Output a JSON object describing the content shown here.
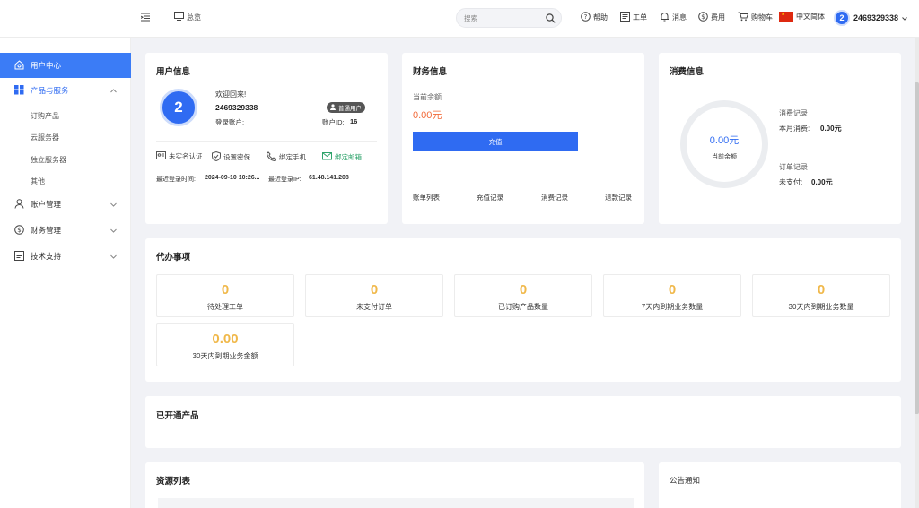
{
  "topbar": {
    "overview_label": "总览",
    "search_placeholder": "搜索",
    "help_label": "帮助",
    "ticket_label": "工单",
    "message_label": "消息",
    "fee_label": "费用",
    "cart_label": "购物车",
    "language_label": "中文简体",
    "user_avatar": "2",
    "username": "2469329338"
  },
  "sidebar": {
    "user_center": "用户中心",
    "products_services": "产品与服务",
    "sub_items": [
      "订购产品",
      "云服务器",
      "独立服务器",
      "其他"
    ],
    "account_mgmt": "账户管理",
    "finance_mgmt": "财务管理",
    "tech_support": "技术支持"
  },
  "user_info": {
    "title": "用户信息",
    "avatar": "2",
    "welcome": "欢迎回来!",
    "username": "2469329338",
    "login_account_label": "登录账户:",
    "role_badge": "普通用户",
    "account_id_label": "账户ID:",
    "account_id": "16",
    "actions": {
      "realname": "未实名认证",
      "security": "设置密保",
      "phone": "绑定手机",
      "email": "绑定邮箱"
    },
    "last_login_time_label": "最近登录时间:",
    "last_login_time": "2024-09-10 10:26...",
    "last_login_ip_label": "最近登录IP:",
    "last_login_ip": "61.48.141.208"
  },
  "finance": {
    "title": "财务信息",
    "balance_label": "当前余额",
    "balance_value": "0.00元",
    "recharge_button": "充值",
    "links": [
      "账单列表",
      "充值记录",
      "消费记录",
      "退款记录"
    ]
  },
  "consumption": {
    "title": "消费信息",
    "ring_value": "0.00元",
    "ring_label": "当前余额",
    "consume_record_label": "消费记录",
    "month_consume_label": "本月消费:",
    "month_consume_value": "0.00元",
    "order_record_label": "订单记录",
    "unpaid_label": "未支付:",
    "unpaid_value": "0.00元"
  },
  "todo": {
    "title": "代办事项",
    "items": [
      {
        "value": "0",
        "label": "待处理工单"
      },
      {
        "value": "0",
        "label": "未支付订单"
      },
      {
        "value": "0",
        "label": "已订购产品数量"
      },
      {
        "value": "0",
        "label": "7天内到期业务数量"
      },
      {
        "value": "0",
        "label": "30天内到期业务数量"
      },
      {
        "value": "0.00",
        "label": "30天内到期业务金额"
      }
    ]
  },
  "opened_products": {
    "title": "已开通产品"
  },
  "resource_list": {
    "title": "资源列表"
  },
  "announcements": {
    "title": "公告通知"
  },
  "colors": {
    "primary": "#2f6bf2",
    "balance": "#f26b3a",
    "todo_number": "#f0b84a",
    "email_bound": "#2ea36b"
  }
}
